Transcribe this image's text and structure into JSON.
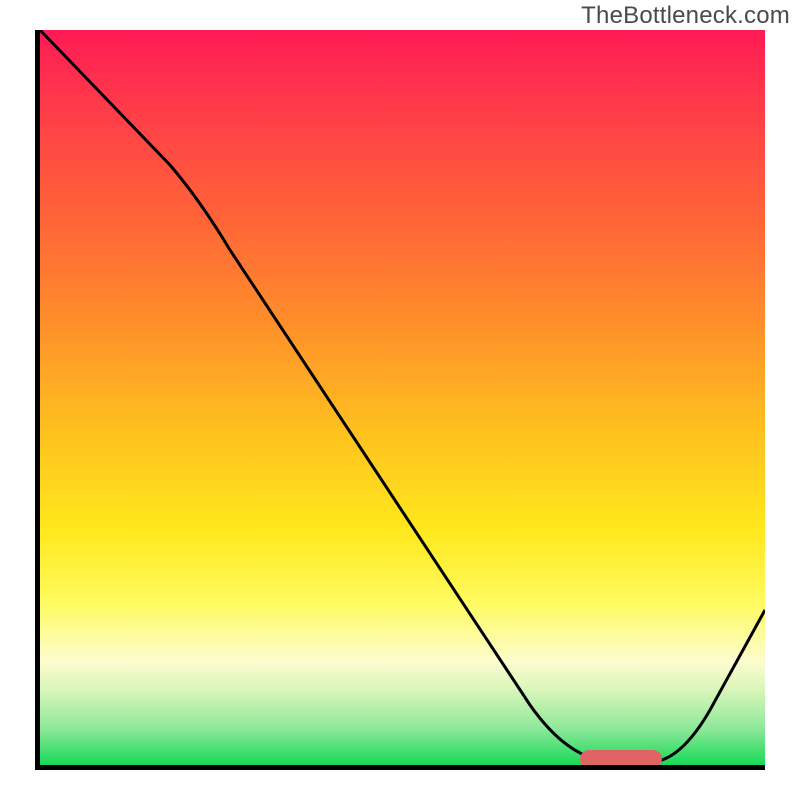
{
  "watermark": "TheBottleneck.com",
  "chart_data": {
    "type": "line",
    "title": "",
    "xlabel": "",
    "ylabel": "",
    "xlim": [
      0,
      1
    ],
    "ylim": [
      0,
      1
    ],
    "background_gradient": {
      "direction": "vertical",
      "stops": [
        {
          "pos": 0.0,
          "color": "#ff1a55"
        },
        {
          "pos": 0.1,
          "color": "#ff3a4a"
        },
        {
          "pos": 0.25,
          "color": "#ff6238"
        },
        {
          "pos": 0.4,
          "color": "#ff8f2a"
        },
        {
          "pos": 0.55,
          "color": "#ffc21e"
        },
        {
          "pos": 0.68,
          "color": "#ffe81c"
        },
        {
          "pos": 0.78,
          "color": "#fffb60"
        },
        {
          "pos": 0.86,
          "color": "#fcfccf"
        },
        {
          "pos": 0.9,
          "color": "#d6f5b8"
        },
        {
          "pos": 0.95,
          "color": "#8ee89a"
        },
        {
          "pos": 1.0,
          "color": "#17d957"
        }
      ]
    },
    "series": [
      {
        "name": "bottleneck-curve",
        "x": [
          0.0,
          0.18,
          0.26,
          0.68,
          0.79,
          0.84,
          0.92,
          1.0
        ],
        "y": [
          1.0,
          0.82,
          0.7,
          0.08,
          0.0,
          0.0,
          0.07,
          0.21
        ],
        "stroke": "#000000",
        "stroke_width": 3
      }
    ],
    "annotations": [
      {
        "name": "optimal-range-marker",
        "shape": "rounded-rect",
        "x_range": [
          0.745,
          0.86
        ],
        "y": 0.0,
        "color": "#e06464"
      }
    ]
  }
}
